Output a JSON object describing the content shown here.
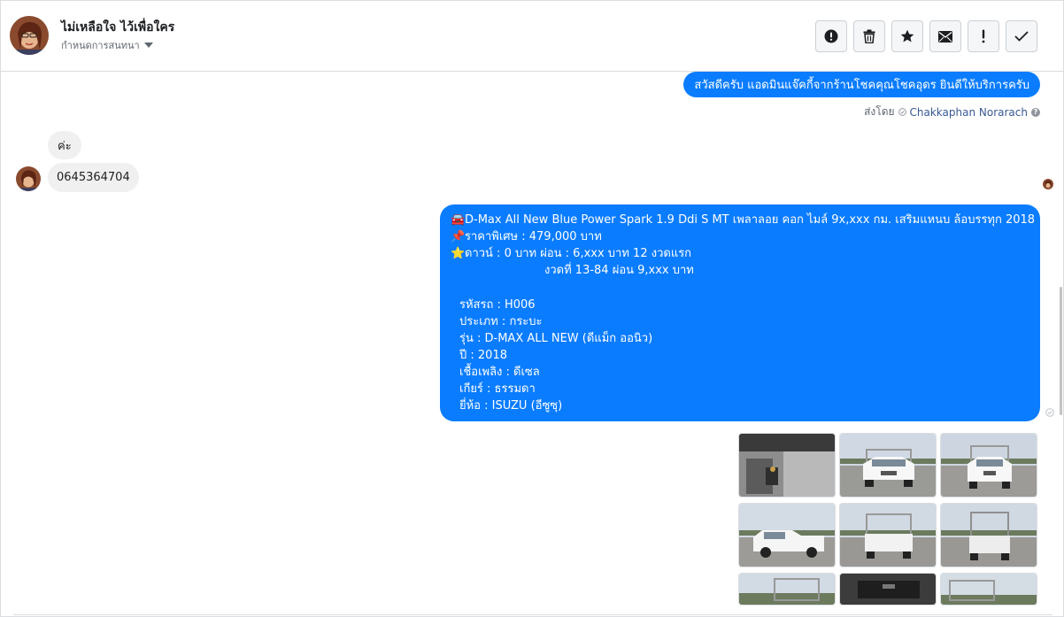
{
  "header": {
    "contact_name": "ไม่เหลือใจ ไว้เพื่อใคร",
    "label_dropdown": "กำหนดการสนทนา",
    "actions": [
      {
        "name": "report-spam-button",
        "icon": "alert-circle-icon"
      },
      {
        "name": "delete-button",
        "icon": "trash-icon"
      },
      {
        "name": "star-button",
        "icon": "star-icon"
      },
      {
        "name": "mark-unread-button",
        "icon": "envelope-icon"
      },
      {
        "name": "follow-up-button",
        "icon": "exclamation-icon"
      },
      {
        "name": "mark-done-button",
        "icon": "check-icon"
      }
    ]
  },
  "conversation": {
    "greeting_message": "สวัสดีครับ แอดมินแจ๊คกี้จากร้านโชคคุณโชคอุดร ยินดีให้บริการครับ",
    "sent_by_prefix": "ส่งโดย",
    "sent_by_agent": "Chakkaphan Norarach",
    "incoming_1": "ค่ะ",
    "incoming_2": "0645364704",
    "listing": {
      "line1": "D-Max All New Blue Power Spark 1.9 Ddi S MT เพลาลอย คอก ไมล์ 9x,xxx กม. เสริมแหนบ ล้อบรรทุก 2018",
      "line2": "ราคาพิเศษ : 479,000 บาท",
      "line3": "ดาวน์ : 0 บาท ผ่อน : 6,xxx บาท 12 งวดแรก",
      "line4": "งวดที่ 13-84 ผ่อน 9,xxx บาท",
      "code": "รหัสรถ : H006",
      "type": "ประเภท : กระบะ",
      "model": "รุ่น : D-MAX ALL NEW (ดีแม็ก ออนิว)",
      "year": "ปี : 2018",
      "fuel": "เชื้อเพลิง : ดีเซล",
      "gear": "เกียร์ : ธรรมดา",
      "brand": "ยี่ห้อ : ISUZU (อีซูซุ)"
    },
    "emoji": {
      "car": "car-emoji-icon",
      "pin": "pushpin-emoji-icon",
      "star": "star-emoji-icon"
    }
  },
  "colors": {
    "outgoing_bubble": "#0a7cff",
    "incoming_bubble": "#f0f0f0",
    "agent_link": "#385898"
  }
}
